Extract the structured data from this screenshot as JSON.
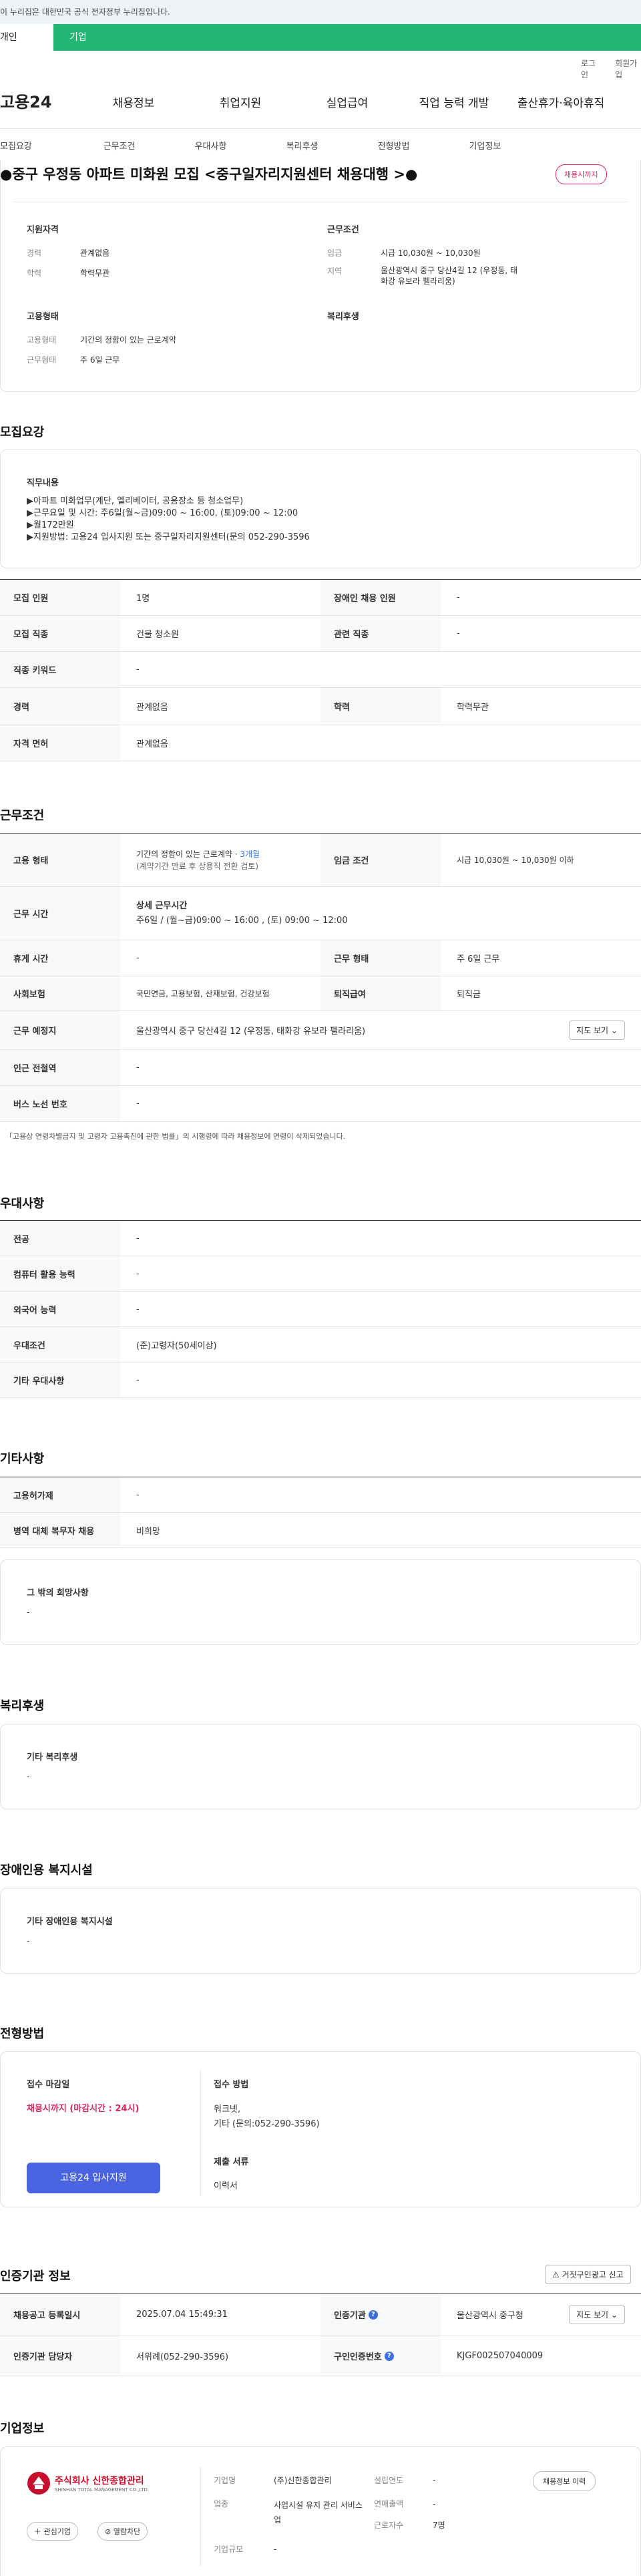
{
  "gov_notice": "이 누리집은 대한민국 공식 전자정부 누리집입니다.",
  "user_tabs": {
    "personal": "개인",
    "company": "기업"
  },
  "top_links": {
    "login": "로그인",
    "join": "회원가입"
  },
  "logo": "고용24",
  "main_nav": [
    "채용정보",
    "취업지원",
    "실업급여",
    "직업 능력 개발",
    "출산휴가·육아휴직"
  ],
  "sub_nav": [
    "모집요강",
    "근무조건",
    "우대사항",
    "복리후생",
    "전형방법",
    "기업정보"
  ],
  "job": {
    "title": "●중구 우정동 아파트 미화원 모집 <중구일자리지원센터 채용대행 >●",
    "status_badge": "채용시까지"
  },
  "summary": {
    "qual_title": "지원자격",
    "qual": [
      {
        "k": "경력",
        "v": "관계없음"
      },
      {
        "k": "학력",
        "v": "학력무관"
      }
    ],
    "emp_title": "고용형태",
    "emp": [
      {
        "k": "고용형태",
        "v": "기간의 정함이 있는 근로계약"
      },
      {
        "k": "근무형태",
        "v": "주 6일 근무"
      }
    ],
    "cond_title": "근무조건",
    "cond": [
      {
        "k": "임금",
        "v": "시급 10,030원 ~ 10,030원"
      },
      {
        "k": "지역",
        "v": "울산광역시 중구 당산4길 12 (우정동, 태화강 유보라 펠라리움)"
      }
    ],
    "welfare_title": "복리후생"
  },
  "recruit": {
    "section_title": "모집요강",
    "duty_title": "직무내용",
    "duty_lines": [
      "▶아파트 미화업무(계단, 엘리베이터, 공용장소 등 청소업무)",
      "▶근무요일 및 시간: 주6일(월~금)09:00 ~ 16:00, (토)09:00 ~ 12:00",
      "▶월172만원",
      "▶지원방법: 고용24 입사지원 또는 중구일자리지원센터(문의 052-290-3596"
    ],
    "rows": [
      {
        "h1": "모집 인원",
        "v1": "1명",
        "h2": "장애인 채용 인원",
        "v2": "-"
      },
      {
        "h1": "모집 직종",
        "v1": "건물 청소원",
        "h2": "관련 직종",
        "v2": "-"
      },
      {
        "h1": "직종 키워드",
        "v1": "-"
      },
      {
        "h1": "경력",
        "v1": "관계없음",
        "h2": "학력",
        "v2": "학력무관"
      },
      {
        "h1": "자격 면허",
        "v1": "관계없음"
      }
    ]
  },
  "work": {
    "section_title": "근무조건",
    "emp_type_h": "고용 형태",
    "emp_type_v1": "기간의 정함이 있는 근로계약 · ",
    "emp_type_months": "3개월",
    "emp_type_v2": "(계약기간 만료 후 상용직 전환 검토)",
    "wage_h": "임금 조건",
    "wage_v": "시급 10,030원 ~ 10,030원 이하",
    "hours_h": "근무 시간",
    "hours_sub": "상세 근무시간",
    "hours_v": "주6일 / (월~금)09:00 ~ 16:00 , (토) 09:00 ~ 12:00",
    "rest_h": "휴게 시간",
    "rest_v": "-",
    "worktype_h": "근무 형태",
    "worktype_v": "주 6일 근무",
    "insure_h": "사회보험",
    "insure_v": "국민연금, 고용보험, 산재보험, 건강보험",
    "retire_h": "퇴직급여",
    "retire_v": "퇴직금",
    "place_h": "근무 예정지",
    "place_v": "울산광역시 중구 당산4길 12 (우정동, 태화강 유보라 펠라리움)",
    "map_btn": "지도 보기",
    "station_h": "인근 전철역",
    "station_v": "-",
    "bus_h": "버스 노선 번호",
    "bus_v": "-",
    "note": "「고용상 연령차별금지 및 고령자 고용촉진에 관한 법률」의 시행령에 따라 채용정보에 연령이 삭제되었습니다."
  },
  "pref": {
    "section_title": "우대사항",
    "rows": [
      {
        "h": "전공",
        "v": "-"
      },
      {
        "h": "컴퓨터 활용 능력",
        "v": "-"
      },
      {
        "h": "외국어 능력",
        "v": "-"
      },
      {
        "h": "우대조건",
        "v": "(준)고령자(50세이상)"
      },
      {
        "h": "기타 우대사항",
        "v": "-"
      }
    ]
  },
  "etc": {
    "section_title": "기타사항",
    "rows": [
      {
        "h": "고용허가제",
        "v": "-"
      },
      {
        "h": "병역 대체 복무자 채용",
        "v": "비희망"
      }
    ],
    "box_title": "그 밖의 희망사항",
    "box_value": "-"
  },
  "welfare": {
    "section_title": "복리후생",
    "box_title": "기타 복리후생",
    "box_value": "-"
  },
  "disability": {
    "section_title": "장애인용 복지시설",
    "box_title": "기타 장애인용 복지시설",
    "box_value": "-"
  },
  "screening": {
    "section_title": "전형방법",
    "deadline_title": "접수 마감일",
    "deadline_value": "채용시까지 (마감시간 : 24시)",
    "apply_btn": "고용24 입사지원",
    "method_title": "접수 방법",
    "method_l1": "워크넷,",
    "method_l2": "기타 (문의:052-290-3596)",
    "docs_title": "제출 서류",
    "docs_value": "이력서"
  },
  "agency": {
    "section_title": "인증기관 정보",
    "report_btn": "거짓구인광고 신고",
    "reg_h": "채용공고 등록일시",
    "reg_v": "2025.07.04 15:49:31",
    "org_h": "인증기관",
    "org_v": "울산광역시 중구청",
    "map_btn": "지도 보기",
    "manager_h": "인증기관 담당자",
    "manager_v": "서위례(052-290-3596)",
    "jobno_h": "구인인증번호",
    "jobno_v": "KJGF002507040009"
  },
  "company": {
    "section_title": "기업정보",
    "logo_name": "주식회사 신한종합관리",
    "logo_sub": "SHINHAN TOTAL MANAGEMENT CO.,LTD.",
    "interest_btn": "관심기업",
    "block_btn": "열람차단",
    "name_k": "기업명",
    "name_v": "(주)신한종합관리",
    "industry_k": "업종",
    "industry_v": "사업시설 유지 관리 서비스업",
    "scale_k": "기업규모",
    "scale_v": "-",
    "founded_k": "설립연도",
    "founded_v": "-",
    "sales_k": "연매출액",
    "sales_v": "-",
    "staff_k": "근로자수",
    "staff_v": "7명",
    "history_btn": "채용정보 이력"
  },
  "colors": {
    "accent_green": "#22b873",
    "badge_red": "#e0245e",
    "primary_blue": "#4a63e0"
  }
}
